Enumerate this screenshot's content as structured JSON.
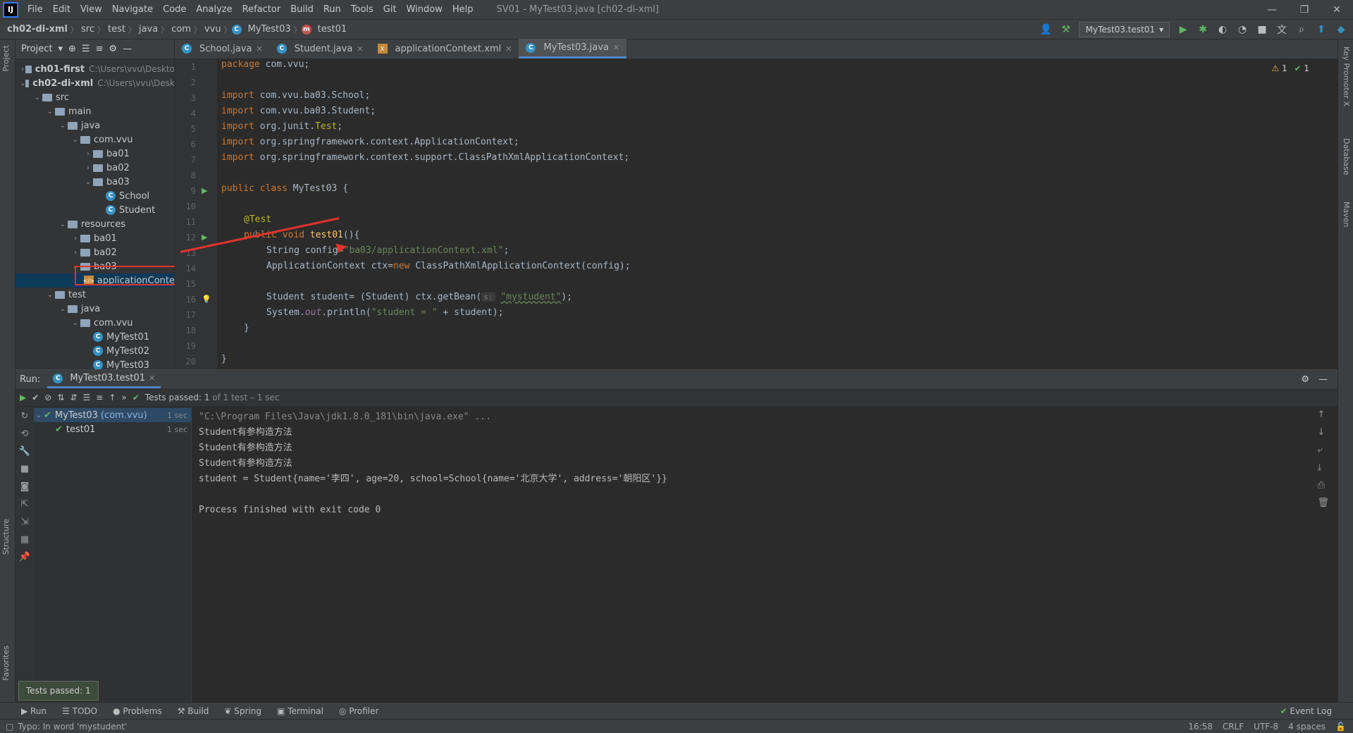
{
  "menu": {
    "logo": "IJ",
    "items": [
      "File",
      "Edit",
      "View",
      "Navigate",
      "Code",
      "Analyze",
      "Refactor",
      "Build",
      "Run",
      "Tools",
      "Git",
      "Window",
      "Help"
    ],
    "title": "SV01 - MyTest03.java [ch02-di-xml]"
  },
  "window_controls": {
    "minimize": "—",
    "maximize": "❐",
    "close": "✕"
  },
  "breadcrumb": [
    "ch02-di-xml",
    "src",
    "test",
    "java",
    "com",
    "vvu",
    "MyTest03",
    "test01"
  ],
  "run_config": "MyTest03.test01",
  "left_strip": {
    "project": "Project",
    "structure": "Structure",
    "favorites": "Favorites"
  },
  "right_strip": {
    "key_promoter": "Key Promoter X",
    "database": "Database",
    "maven": "Maven"
  },
  "project": {
    "header": "Project",
    "tree": [
      {
        "label": "ch01-first",
        "path": "C:\\Users\\vvu\\Deskto",
        "kind": "module",
        "indent": 0,
        "arrow": "›"
      },
      {
        "label": "ch02-di-xml",
        "path": "C:\\Users\\vvu\\Desk",
        "kind": "module",
        "indent": 0,
        "arrow": "⌄"
      },
      {
        "label": "src",
        "kind": "folder",
        "indent": 1,
        "arrow": "⌄"
      },
      {
        "label": "main",
        "kind": "folder",
        "indent": 2,
        "arrow": "⌄"
      },
      {
        "label": "java",
        "kind": "folder",
        "indent": 3,
        "arrow": "⌄"
      },
      {
        "label": "com.vvu",
        "kind": "folder",
        "indent": 4,
        "arrow": "⌄"
      },
      {
        "label": "ba01",
        "kind": "folder",
        "indent": 5,
        "arrow": "›"
      },
      {
        "label": "ba02",
        "kind": "folder",
        "indent": 5,
        "arrow": "›"
      },
      {
        "label": "ba03",
        "kind": "folder",
        "indent": 5,
        "arrow": "⌄"
      },
      {
        "label": "School",
        "kind": "class",
        "indent": 6,
        "arrow": ""
      },
      {
        "label": "Student",
        "kind": "class",
        "indent": 6,
        "arrow": ""
      },
      {
        "label": "resources",
        "kind": "folder",
        "indent": 3,
        "arrow": "⌄"
      },
      {
        "label": "ba01",
        "kind": "folder",
        "indent": 4,
        "arrow": "›"
      },
      {
        "label": "ba02",
        "kind": "folder",
        "indent": 4,
        "arrow": "›"
      },
      {
        "label": "ba03",
        "kind": "folder",
        "indent": 4,
        "arrow": "⌄"
      },
      {
        "label": "applicationConte",
        "kind": "xml",
        "indent": 5,
        "arrow": "",
        "selected": true
      },
      {
        "label": "test",
        "kind": "folder",
        "indent": 2,
        "arrow": "⌄"
      },
      {
        "label": "java",
        "kind": "folder",
        "indent": 3,
        "arrow": "⌄"
      },
      {
        "label": "com.vvu",
        "kind": "folder",
        "indent": 4,
        "arrow": "⌄"
      },
      {
        "label": "MyTest01",
        "kind": "class",
        "indent": 5,
        "arrow": ""
      },
      {
        "label": "MyTest02",
        "kind": "class",
        "indent": 5,
        "arrow": ""
      },
      {
        "label": "MyTest03",
        "kind": "class",
        "indent": 5,
        "arrow": ""
      }
    ]
  },
  "tabs": [
    {
      "label": "School.java",
      "icon": "C",
      "active": false
    },
    {
      "label": "Student.java",
      "icon": "C",
      "active": false
    },
    {
      "label": "applicationContext.xml",
      "icon": "X",
      "active": false
    },
    {
      "label": "MyTest03.java",
      "icon": "C",
      "active": true
    }
  ],
  "inspections": {
    "warnings": "1",
    "ok": "1"
  },
  "line_numbers": [
    "1",
    "2",
    "3",
    "4",
    "5",
    "6",
    "7",
    "8",
    "9",
    "10",
    "11",
    "12",
    "13",
    "14",
    "15",
    "16",
    "17",
    "18",
    "19",
    "20"
  ],
  "code": {
    "l1a": "package ",
    "l1b": "com.vvu;",
    "l3a": "import ",
    "l3b": "com.vvu.ba03.School;",
    "l4a": "import ",
    "l4b": "com.vvu.ba03.Student;",
    "l5a": "import ",
    "l5b": "org.junit.",
    "l5c": "Test",
    ";": ";",
    "l6a": "import ",
    "l6b": "org.springframework.context.ApplicationContext;",
    "l7a": "import ",
    "l7b": "org.springframework.context.support.ClassPathXmlApplicationContext;",
    "l9a": "public class ",
    "l9b": "MyTest03 {",
    "l11": "@Test",
    "l12a": "public void ",
    "l12b": "test01",
    "l12c": "(){",
    "l13a": "String config=",
    "l13b": "\"ba03/applicationContext.xml\"",
    "l13c": ";",
    "l14a": "ApplicationContext ctx=",
    "l14b": "new ",
    "l14c": "ClassPathXmlApplicationContext(config);",
    "l16a": "Student student= (Student) ctx.getBean(",
    "l16h": "s:",
    "l16b": "\"mystudent\"",
    "l16c": ");",
    "l17a": "System.",
    "l17b": "out",
    "l17c": ".println(",
    "l17d": "\"student = \"",
    "l17e": " + student);",
    "l18": "}",
    "l20": "}"
  },
  "run": {
    "label": "Run:",
    "tab": "MyTest03.test01",
    "status_prefix": "Tests passed: ",
    "status_count": "1",
    "status_suffix": " of 1 test – 1 sec",
    "tree": [
      {
        "label": "MyTest03",
        "pkg": "(com.vvu)",
        "time": "1 sec"
      },
      {
        "label": "test01",
        "time": "1 sec"
      }
    ],
    "console": [
      "\"C:\\Program Files\\Java\\jdk1.8.0_181\\bin\\java.exe\" ...",
      "Student有参构造方法",
      "Student有参构造方法",
      "Student有参构造方法",
      "student = Student{name='李四', age=20, school=School{name='北京大学', address='朝阳区'}}",
      "",
      "Process finished with exit code 0"
    ]
  },
  "toast": "Tests passed: 1",
  "bottom_tabs": [
    "Run",
    "TODO",
    "Problems",
    "Build",
    "Spring",
    "Terminal",
    "Profiler"
  ],
  "event_log": "Event Log",
  "status": {
    "message": "Typo: In word 'mystudent'",
    "position": "16:58",
    "line_sep": "CRLF",
    "encoding": "UTF-8",
    "indent": "4 spaces"
  }
}
